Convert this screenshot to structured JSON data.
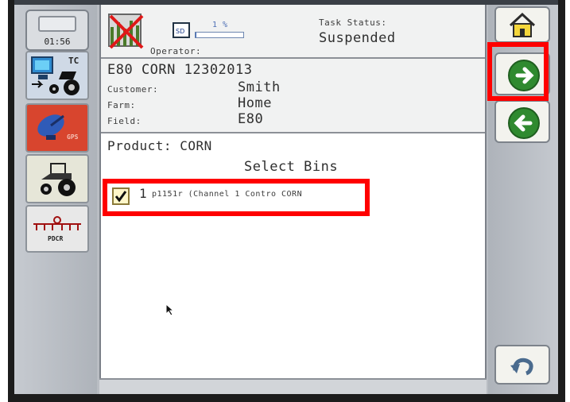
{
  "sidebar": {
    "clock": "01:56",
    "tc_label": "TC",
    "gps_label": "GPS",
    "pdcr_label": "PDCR"
  },
  "status": {
    "progress_text": "1 %",
    "progress_percent": 1,
    "operator_label": "Operator:",
    "task_status_label": "Task Status:",
    "task_status_value": "Suspended"
  },
  "job": {
    "title": "E80 CORN 12302013",
    "customer_label": "Customer:",
    "customer_value": "Smith",
    "farm_label": "Farm:",
    "farm_value": "Home",
    "field_label": "Field:",
    "field_value": "E80"
  },
  "product": {
    "label": "Product: CORN",
    "select_bins_title": "Select Bins",
    "bins": [
      {
        "number": "1",
        "checked": true,
        "name": "p1151r (Channel 1 Contro CORN"
      }
    ]
  },
  "right": {
    "home": "home-icon",
    "next": "arrow-right-icon",
    "back": "arrow-left-icon",
    "undo": "undo-icon"
  },
  "colors": {
    "highlight": "#ff0000",
    "arrow_green": "#2f8a2f",
    "status_red": "#d8452e"
  }
}
